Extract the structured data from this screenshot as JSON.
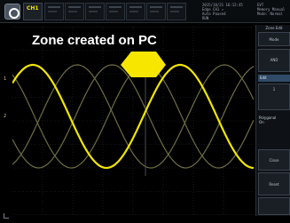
{
  "top_bar": {
    "channel_tab_label": "CH1",
    "status_lines": [
      "2015/10/21 16:12:45",
      "Edge CH1 ↗",
      "Auto   Paused",
      "RUN"
    ],
    "right_status": [
      "EVT",
      "Memory Manual",
      "Mode: Normal"
    ]
  },
  "caption": "Zone created on PC",
  "panel": {
    "title": "Zone Edit",
    "mode_label": "Mode",
    "logic_label": "AND",
    "selected_value": "Edit",
    "field_label": "1",
    "option_label": "Polygonal",
    "option_value": "On",
    "button_close": "Close",
    "button_reset": "Reset"
  },
  "left_markers": [
    "1",
    "2"
  ],
  "colors": {
    "trace": "#f2e600",
    "zone_fill": "#f7e600",
    "grid": "#2b2f34",
    "background": "#000000"
  }
}
